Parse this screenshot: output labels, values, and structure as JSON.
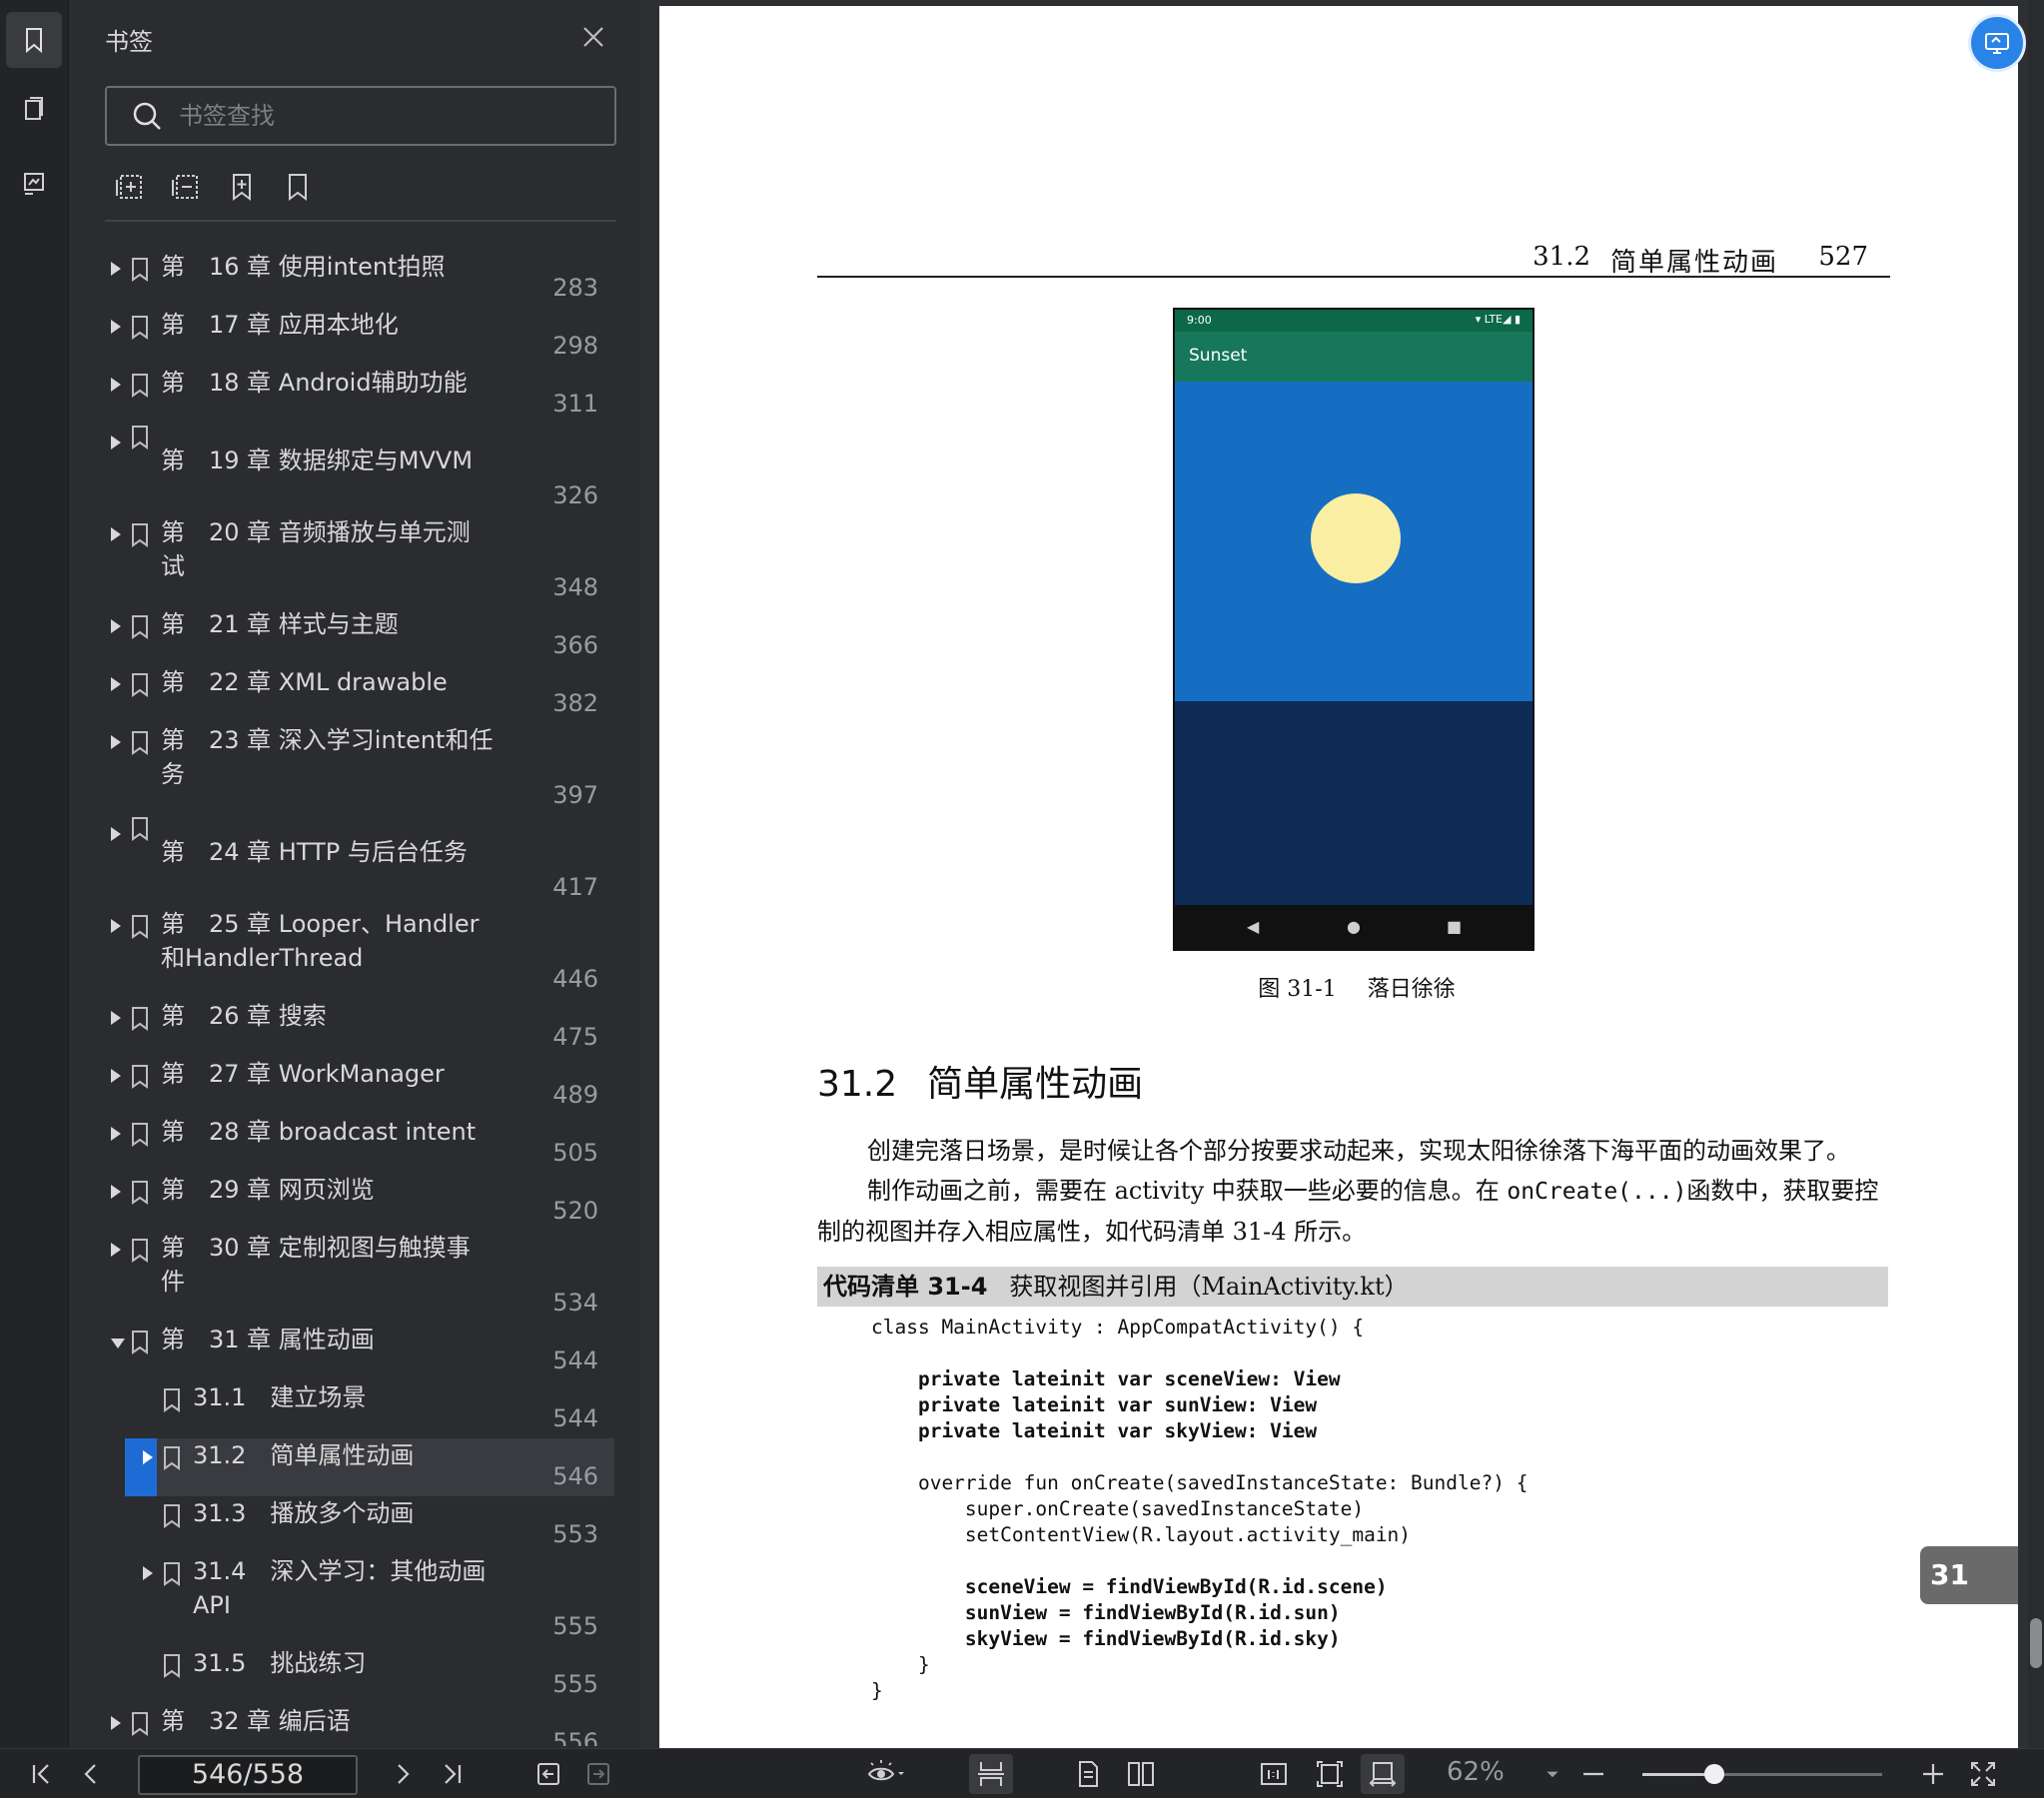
{
  "panel": {
    "title": "书签",
    "search_placeholder": "书签查找"
  },
  "bookmarks": [
    {
      "label": "第　16 章 使用intent拍照",
      "page": "283",
      "level": 0,
      "expander": "right"
    },
    {
      "label": "第　17 章 应用本地化",
      "page": "298",
      "level": 0,
      "expander": "right"
    },
    {
      "label": "第　18 章 Android辅助功能",
      "page": "311",
      "level": 0,
      "expander": "right"
    },
    {
      "label": "第　19 章 数据绑定与MVVM",
      "page": "326",
      "level": 0,
      "expander": "right"
    },
    {
      "label": "第　20 章 音频播放与单元测\n试",
      "page": "348",
      "level": 0,
      "expander": "right"
    },
    {
      "label": "第　21 章 样式与主题",
      "page": "366",
      "level": 0,
      "expander": "right"
    },
    {
      "label": "第　22 章 XML drawable",
      "page": "382",
      "level": 0,
      "expander": "right"
    },
    {
      "label": "第　23 章 深入学习intent和任\n务",
      "page": "397",
      "level": 0,
      "expander": "right"
    },
    {
      "label": "第　24 章 HTTP 与后台任务",
      "page": "417",
      "level": 0,
      "expander": "right"
    },
    {
      "label": "第　25 章 Looper、Handler\n和HandlerThread",
      "page": "446",
      "level": 0,
      "expander": "right"
    },
    {
      "label": "第　26 章 搜索",
      "page": "475",
      "level": 0,
      "expander": "right"
    },
    {
      "label": "第　27 章 WorkManager",
      "page": "489",
      "level": 0,
      "expander": "right"
    },
    {
      "label": "第　28 章 broadcast intent",
      "page": "505",
      "level": 0,
      "expander": "right"
    },
    {
      "label": "第　29 章 网页浏览",
      "page": "520",
      "level": 0,
      "expander": "right"
    },
    {
      "label": "第　30 章 定制视图与触摸事\n件",
      "page": "534",
      "level": 0,
      "expander": "right"
    },
    {
      "label": "第　31 章 属性动画",
      "page": "544",
      "level": 0,
      "expander": "down"
    },
    {
      "label": "31.1　建立场景",
      "page": "544",
      "level": 1,
      "expander": "none"
    },
    {
      "label": "31.2　简单属性动画",
      "page": "546",
      "level": 1,
      "expander": "right",
      "selected": true
    },
    {
      "label": "31.3　播放多个动画",
      "page": "553",
      "level": 1,
      "expander": "none"
    },
    {
      "label": "31.4　深入学习：其他动画\nAPI",
      "page": "555",
      "level": 1,
      "expander": "right"
    },
    {
      "label": "31.5　挑战练习",
      "page": "555",
      "level": 1,
      "expander": "none"
    },
    {
      "label": "第　32 章 编后语",
      "page": "556",
      "level": 0,
      "expander": "right"
    }
  ],
  "document": {
    "running_head": {
      "section": "31.2",
      "title": "简单属性动画",
      "page": "527"
    },
    "figure": {
      "phone_time": "9:00",
      "phone_status_icons": "▾ LTE◢ ▮",
      "app_title": "Sunset",
      "nav_back": "◀",
      "nav_home": "●",
      "nav_recent": "■",
      "caption_num": "图 31-1",
      "caption_text": "落日徐徐"
    },
    "section_heading": {
      "number": "31.2",
      "title": "简单属性动画"
    },
    "paragraph1": "创建完落日场景，是时候让各个部分按要求动起来，实现太阳徐徐落下海平面的动画效果了。",
    "paragraph2_a": "制作动画之前，需要在 activity 中获取一些必要的信息。在 ",
    "paragraph2_code": "onCreate(...)",
    "paragraph2_b": "函数中，获取要控制的视图并存入相应属性，如代码清单 31-4 所示。",
    "code_listing": {
      "label": "代码清单 31-4",
      "title": "获取视图并引用（MainActivity.kt）",
      "lines": [
        "class MainActivity : AppCompatActivity() {",
        "",
        "    private lateinit var sceneView: View",
        "    private lateinit var sunView: View",
        "    private lateinit var skyView: View",
        "",
        "    override fun onCreate(savedInstanceState: Bundle?) {",
        "        super.onCreate(savedInstanceState)",
        "        setContentView(R.layout.activity_main)",
        "",
        "        sceneView = findViewById(R.id.scene)",
        "        sunView = findViewById(R.id.sun)",
        "        skyView = findViewById(R.id.sky)",
        "    }",
        "}"
      ],
      "bold_lines": [
        2,
        3,
        4,
        10,
        11,
        12
      ]
    },
    "chapter_tab": "31"
  },
  "toolbar": {
    "page_indicator": "546/558",
    "zoom": "62%",
    "zoom_level": 0.3
  }
}
